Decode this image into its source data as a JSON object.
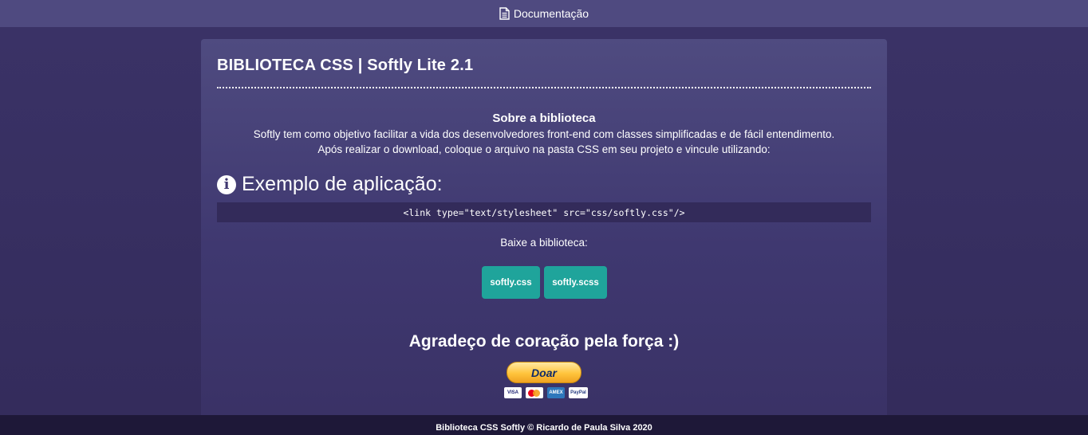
{
  "nav": {
    "doc_icon": "document-icon",
    "doc_label": "Documentação"
  },
  "card": {
    "title": "BIBLIOTECA CSS | Softly Lite 2.1",
    "about_heading": "Sobre a biblioteca",
    "about_line1": "Softly tem como objetivo facilitar a vida dos desenvolvedores front-end com classes simplificadas e de fácil entendimento.",
    "about_line2": "Após realizar o download, coloque o arquivo na pasta CSS em seu projeto e vincule utilizando:",
    "example_icon": "info-circle-icon",
    "example_heading": "Exemplo de aplicação:",
    "code_snippet": "<link type=\"text/stylesheet\" src=\"css/softly.css\"/>",
    "download_label": "Baixe a biblioteca:",
    "buttons": [
      {
        "label": "softly.css"
      },
      {
        "label": "softly.scss"
      }
    ],
    "thanks": "Agradeço de coração pela força :)",
    "donate_label": "Doar",
    "payment_cards": [
      "VISA",
      "mastercard",
      "AMEX",
      "PayPal"
    ]
  },
  "footer": {
    "text": "Biblioteca CSS Softly © Ricardo de Paula Silva 2020"
  },
  "colors": {
    "topbar": "#4f4a80",
    "background": "#352d5e",
    "card_top": "#4f4b80",
    "code_bg": "#332b5a",
    "button": "#1fa49b",
    "footer": "#1e1838",
    "donate": "#ffc43c"
  }
}
